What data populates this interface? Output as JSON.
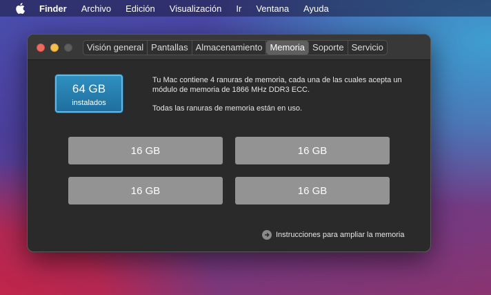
{
  "menubar": {
    "apple_icon": "apple-logo-icon",
    "items": [
      "Finder",
      "Archivo",
      "Edición",
      "Visualización",
      "Ir",
      "Ventana",
      "Ayuda"
    ]
  },
  "window": {
    "tabs": [
      "Visión general",
      "Pantallas",
      "Almacenamiento",
      "Memoria",
      "Soporte",
      "Servicio"
    ],
    "active_tab": "Memoria",
    "installed": {
      "size": "64 GB",
      "caption": "instalados"
    },
    "description_1": "Tu Mac contiene 4 ranuras de memoria, cada una de las cuales acepta un módulo de memoria de 1866 MHz DDR3 ECC.",
    "description_2": "Todas las ranuras de memoria están en uso.",
    "slots": [
      "16 GB",
      "16 GB",
      "16 GB",
      "16 GB"
    ],
    "instructions_link": "Instrucciones para ampliar la memoria",
    "accent_color": "#2a87b9"
  }
}
